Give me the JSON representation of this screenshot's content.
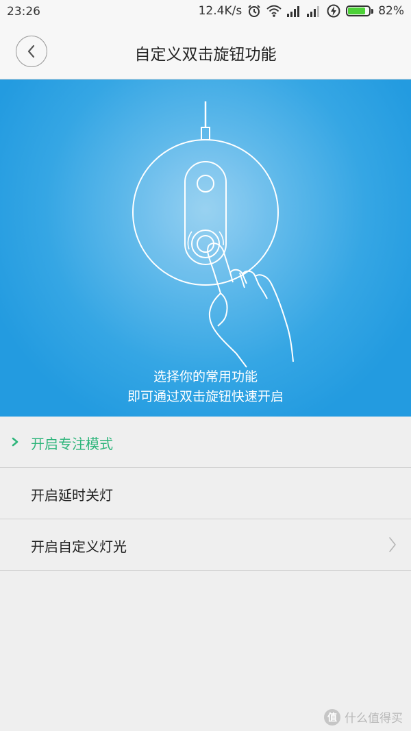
{
  "status_bar": {
    "time": "23:26",
    "network_speed": "12.4K/s",
    "battery_percent": "82%",
    "battery_level": 0.82,
    "icons": [
      "alarm-icon",
      "wifi-icon",
      "signal-icon",
      "signal-icon",
      "charging-icon",
      "battery-icon"
    ]
  },
  "header": {
    "title": "自定义双击旋钮功能",
    "back_icon": "chevron-left-icon"
  },
  "hero": {
    "caption_line1": "选择你的常用功能",
    "caption_line2": "即可通过双击旋钮快速开启",
    "illustration": "knob-hand-double-tap-illustration"
  },
  "options": [
    {
      "label": "开启专注模式",
      "selected": true
    },
    {
      "label": "开启延时关灯",
      "selected": false
    },
    {
      "label": "开启自定义灯光",
      "selected": false,
      "has_chevron": true
    }
  ],
  "colors": {
    "accent": "#2eb57b",
    "hero_blue": "#239be0",
    "background": "#efefef"
  },
  "watermark": {
    "badge": "值",
    "text": "什么值得买"
  }
}
